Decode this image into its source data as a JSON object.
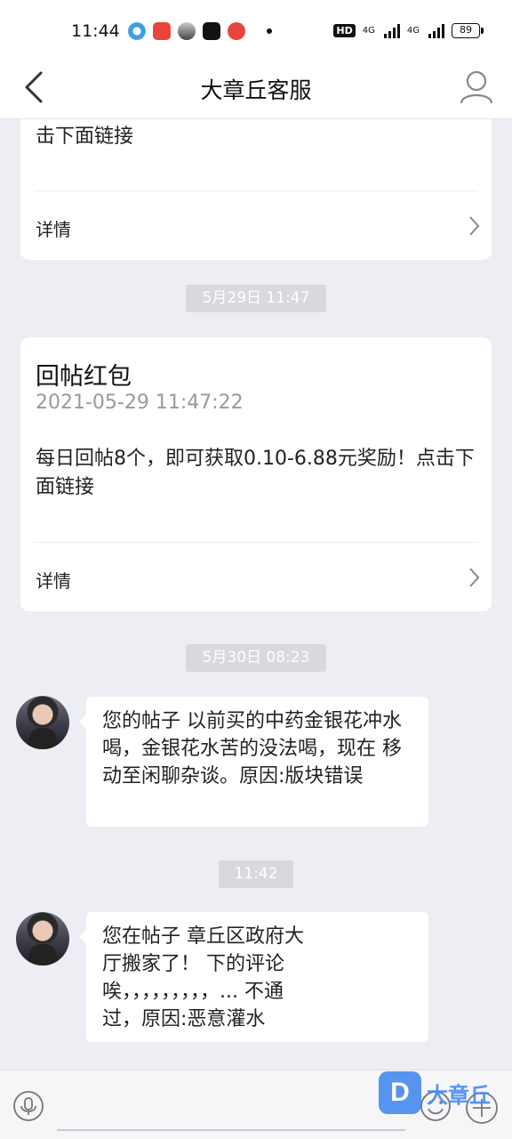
{
  "status_bar": {
    "time": "11:44",
    "hd_label": "HD",
    "signal_1_label": "4G",
    "signal_2_label": "4G",
    "battery": "89",
    "app_icons": [
      "browser-icon",
      "toutiao-icon",
      "app-icon",
      "tiktok-icon",
      "video-icon"
    ]
  },
  "header": {
    "title": "大章丘客服"
  },
  "messages": {
    "card_1": {
      "text": "击下面链接",
      "details_label": "详情"
    },
    "time_1": "5月29日 11:47",
    "card_2": {
      "title": "回帖红包",
      "date": "2021-05-29 11:47:22",
      "text": "每日回帖8个，即可获取0.10-6.88元奖励！点击下面链接",
      "details_label": "详情"
    },
    "time_2": "5月30日 08:23",
    "bubble_1": "您的帖子 以前买的中药金银花冲水喝，金银花水苦的没法喝，现在 移动至闲聊杂谈。原因:版块错误",
    "time_3": "11:42",
    "bubble_2_line_1": "您在帖子 章丘区政府大",
    "bubble_2_line_2": "厅搬家了！ 下的评论",
    "bubble_2_line_3": "唉，，，，，，，，，... 不通",
    "bubble_2_line_4": "过，原因:恶意灌水"
  },
  "input": {
    "value": ""
  },
  "watermark": {
    "logo_letter": "D",
    "text": "大章丘"
  },
  "colors": {
    "background": "#eceef3",
    "watermark_blue": "#4a8cf0",
    "time_pill": "#d8d9dd"
  }
}
